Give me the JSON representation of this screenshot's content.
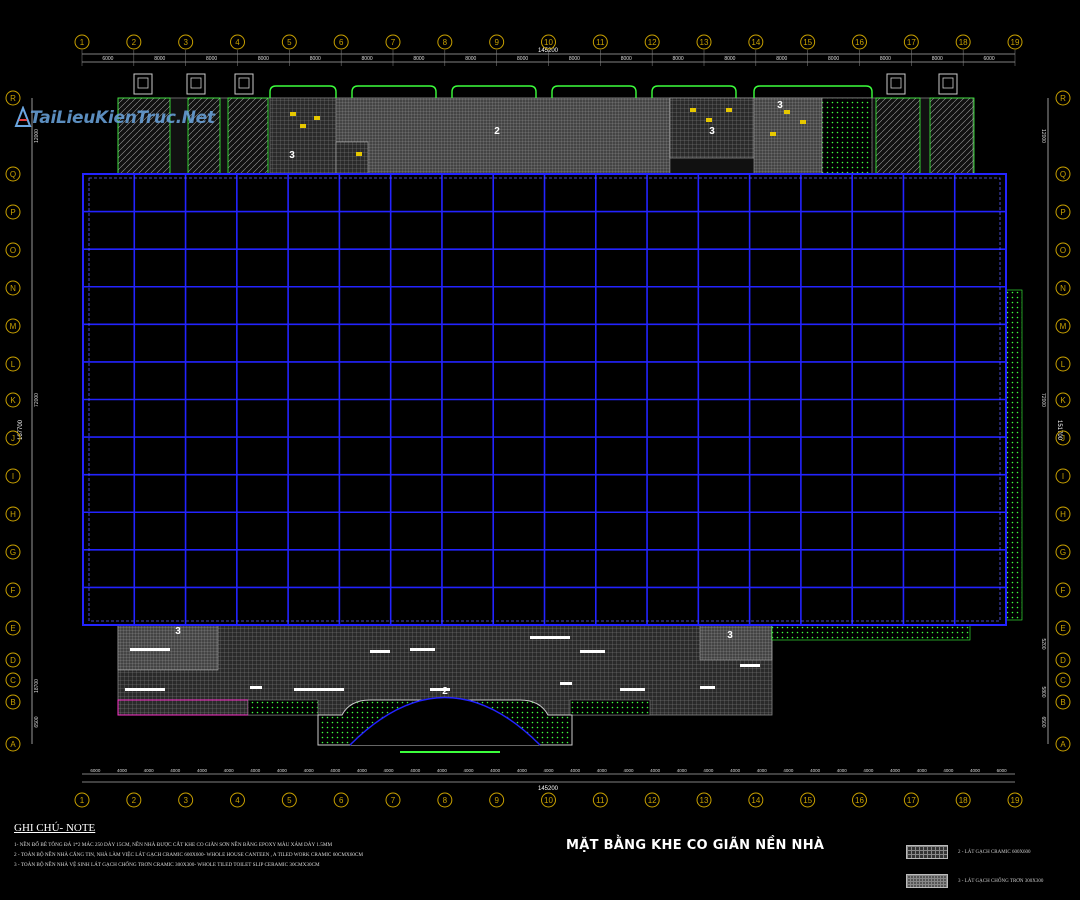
{
  "watermark": {
    "text": "TaiLieuKienTruc.Net"
  },
  "drawing": {
    "top_axes": [
      "1",
      "2",
      "3",
      "4",
      "5",
      "6",
      "7",
      "8",
      "9",
      "10",
      "11",
      "12",
      "13",
      "14",
      "15",
      "16",
      "17",
      "18",
      "19"
    ],
    "left_axes": [
      "R",
      "Q",
      "P",
      "O",
      "N",
      "M",
      "L",
      "K",
      "J",
      "I",
      "H",
      "G",
      "F",
      "E",
      "D",
      "C",
      "B",
      "A"
    ],
    "overall_width_label": "145200",
    "overall_height_label_right": "151700",
    "overall_height_label_left": "167700",
    "left_segment_labels": [
      "12000",
      "72000",
      "18700",
      "6500"
    ],
    "right_segment_labels": [
      "12000",
      "72000",
      "5200",
      "5800",
      "6500"
    ],
    "top_bay_labels": [
      "6000",
      "8000",
      "8000",
      "8000",
      "8000",
      "8000",
      "8000",
      "8000",
      "8000",
      "8000",
      "8000",
      "8000",
      "8000",
      "8000",
      "8000",
      "8000",
      "8000",
      "6000"
    ],
    "bottom_bay_labels": [
      "6000",
      "4000",
      "4000",
      "4000",
      "4000",
      "4000",
      "4000",
      "4000",
      "4000",
      "4000",
      "4000",
      "4000",
      "4000",
      "4000",
      "4000",
      "4000",
      "4000",
      "4000",
      "4000",
      "4000",
      "4000",
      "4000",
      "4000",
      "4000",
      "4000",
      "4000",
      "4000",
      "4000",
      "4000",
      "4000",
      "4000",
      "4000",
      "4000",
      "4000",
      "6000"
    ],
    "zone_labels": [
      "2",
      "3",
      "3",
      "3",
      "3",
      "3",
      "2"
    ]
  },
  "notes": {
    "title": "GHI CHÚ- NOTE",
    "lines": [
      "1- NỀN ĐỔ BÊ TÔNG ĐÁ 1*2 MÁC 250 DÀY 15CM, NỀN NHÀ ĐƯỢC CẮT KHE CO GIÃN SƠN NỀN BẰNG EPOXY MÀU XÁM DÀY 1.5MM",
      "2 - TOÀN BỘ NỀN NHÀ CĂNG TIN, NHÀ LÀM VIỆC LÁT GẠCH CRAMIC 600X600- WHOLE HOUSE CANTEEN , A TILED WORK CRAMIC 60CMX60CM",
      "3 - TOÀN BỘ NỀN NHÀ VỆ SINH LÁT GẠCH CHỐNG TRƠN CRAMIC 300X300- WHOLE TILED TOILET SLIP CERAMIC 30CMX30CM"
    ]
  },
  "plan_title": "MẶT BẰNG KHE CO GIÃN NỀN NHÀ",
  "legend": [
    {
      "label": "2 - LÁT GẠCH CRAMIC 600X600"
    },
    {
      "label": "3 - LÁT GẠCH CHỐNG TRƠN 300X300"
    }
  ],
  "colors": {
    "background": "#000000",
    "grid": "#2323ff",
    "axis_bubble": "#c8a000",
    "dimension": "#ffffff",
    "landscape": "#00ff00",
    "magenta": "#ff33cc"
  }
}
